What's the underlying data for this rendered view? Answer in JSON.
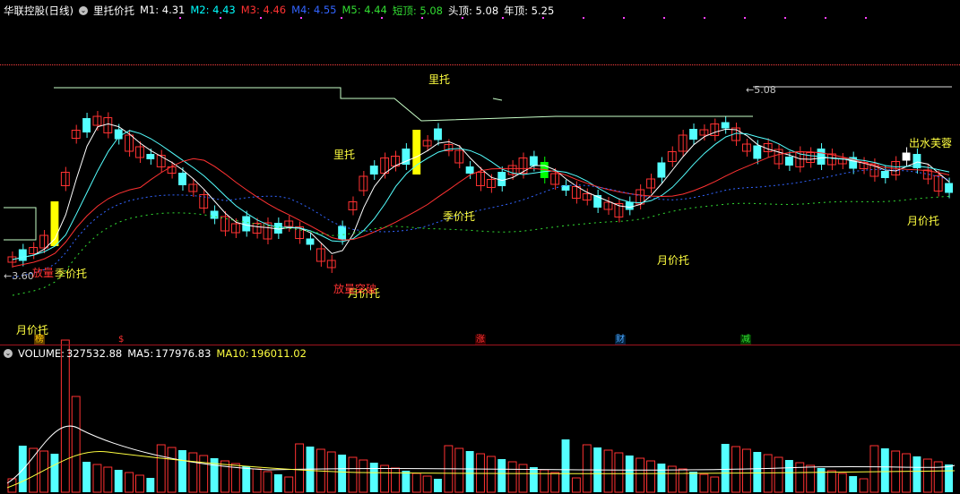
{
  "header": {
    "title": "华联控股(日线)",
    "indicator_name": "里托价托",
    "values": [
      {
        "label": "M1:",
        "value": "4.31",
        "color": "#ffffff"
      },
      {
        "label": "M2:",
        "value": "4.43",
        "color": "#00ffff"
      },
      {
        "label": "M3:",
        "value": "4.46",
        "color": "#ff3232"
      },
      {
        "label": "M4:",
        "value": "4.55",
        "color": "#3264ff"
      },
      {
        "label": "M5:",
        "value": "4.44",
        "color": "#32dc32"
      },
      {
        "label": "短顶:",
        "value": "5.08",
        "color": "#32dc32"
      },
      {
        "label": "头顶:",
        "value": "5.08",
        "color": "#ffffff"
      },
      {
        "label": "年顶:",
        "value": "5.25",
        "color": "#ffffff"
      }
    ]
  },
  "volume_header": {
    "label": "VOLUME:",
    "value": "327532.88",
    "ma5_label": "MA5:",
    "ma5_value": "177976.83",
    "ma10_label": "MA10:",
    "ma10_value": "196011.02"
  },
  "price_markers": {
    "high_marker": "5.08",
    "low_marker": "3.60"
  },
  "annotations": {
    "li_tuo_top": "里托",
    "li_tuo_mid": "里托",
    "ji_jia_tuo_1": "季价托",
    "ji_jia_tuo_2": "季价托",
    "yue_jia_tuo_1": "月价托",
    "yue_jia_tuo_2": "月价托",
    "yue_jia_tuo_3": "月价托",
    "yue_jia_tuo_4": "月价托",
    "fang_liang_1": "放量",
    "fang_liang_2": "放量突破",
    "chu_shui": "出水芙蓉"
  },
  "badges": [
    {
      "text": "榜",
      "color": "#ffcc00",
      "bg": "#5a3a00"
    },
    {
      "text": "$",
      "color": "#ff3232",
      "bg": "transparent"
    },
    {
      "text": "涨",
      "color": "#ff3232",
      "bg": "#3a0000"
    },
    {
      "text": "财",
      "color": "#4da6ff",
      "bg": "#00203a"
    },
    {
      "text": "减",
      "color": "#32dc32",
      "bg": "#003a00"
    }
  ],
  "colors": {
    "up": "#ff3232",
    "down": "#54ffff",
    "breakout": "#ffff00",
    "bull": "#00ff00",
    "white_candle": "#ffffff"
  }
}
